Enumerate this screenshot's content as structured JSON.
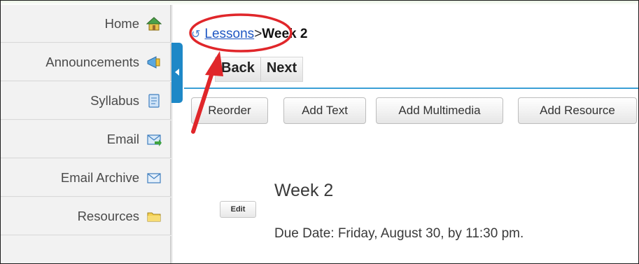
{
  "sidebar": {
    "items": [
      {
        "label": "Home",
        "icon": "home-icon"
      },
      {
        "label": "Announcements",
        "icon": "announcements-icon"
      },
      {
        "label": "Syllabus",
        "icon": "syllabus-icon"
      },
      {
        "label": "Email",
        "icon": "email-icon"
      },
      {
        "label": "Email Archive",
        "icon": "email-archive-icon"
      },
      {
        "label": "Resources",
        "icon": "resources-icon"
      }
    ]
  },
  "breadcrumb": {
    "link_label": "Lessons",
    "separator": ">",
    "current_label": "Week 2"
  },
  "nav": {
    "back_label": "Back",
    "next_label": "Next"
  },
  "toolbar": {
    "reorder_label": "Reorder",
    "add_text_label": "Add Text",
    "add_multimedia_label": "Add Multimedia",
    "add_resource_label": "Add Resource"
  },
  "content": {
    "edit_label": "Edit",
    "title": "Week 2",
    "due_text": "Due Date: Friday, August 30, by 11:30 pm."
  },
  "colors": {
    "accent": "#1e88c7",
    "link": "#1f57c3",
    "annotation_red": "#e0262a"
  }
}
